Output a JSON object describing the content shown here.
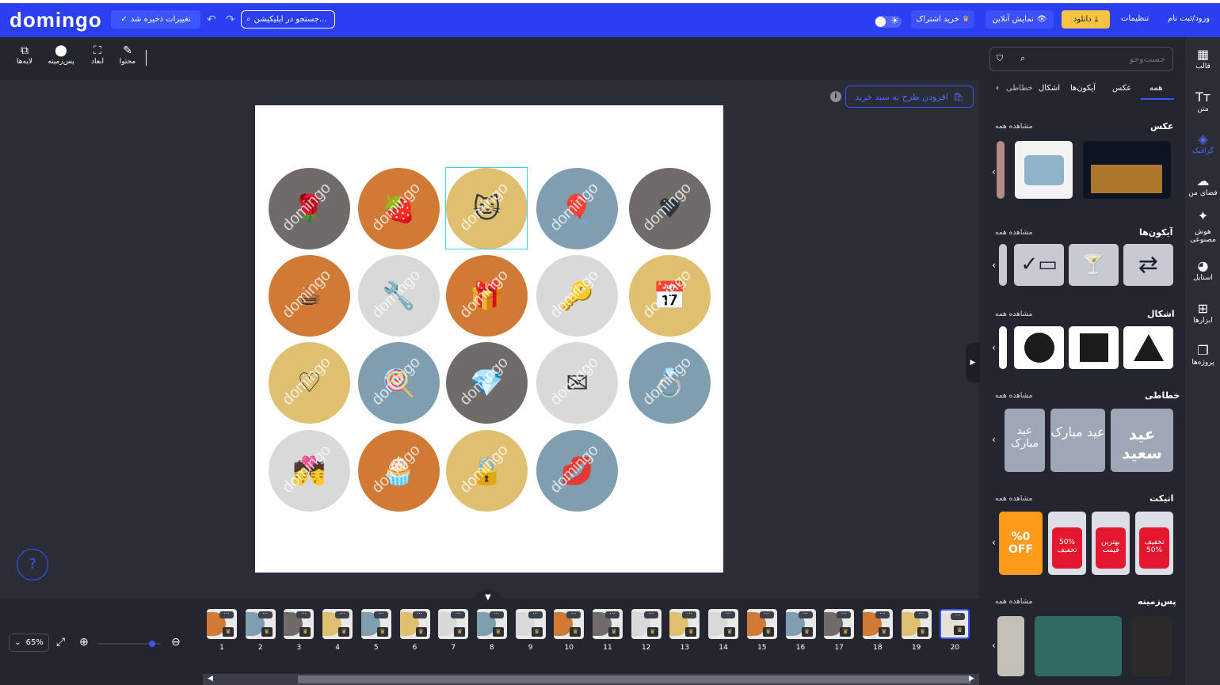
{
  "topbar": {
    "logo": "domingo",
    "saved_label": "تغییرات ذخیره شد",
    "search_placeholder": "جستجو در اپلیکیشن...",
    "subscribe_label": "خرید اشتراک",
    "preview_label": "نمایش آنلاین",
    "download_label": "دانلود",
    "settings_label": "تنظیمات",
    "login_label": "ورود/ثبت نام"
  },
  "toolbar": {
    "content_label": "محتوا",
    "dimensions_label": "ابعاد",
    "background_label": "پس‌زمینه",
    "layers_label": "لایه‌ها"
  },
  "canvas_actions": {
    "add_to_cart_label": "افزودن طرح به سبد خرید",
    "info_icon": "i"
  },
  "canvas": {
    "watermark": "domingo",
    "circles": [
      {
        "color": "#6e6b68",
        "icon": "🌹"
      },
      {
        "color": "#d07a36",
        "icon": "🍓"
      },
      {
        "color": "#dfc070",
        "icon": "🐱"
      },
      {
        "color": "#7f9fb0",
        "icon": "🎈"
      },
      {
        "color": "#6e6b68",
        "icon": "♥"
      },
      {
        "color": "#d07a36",
        "icon": "☕"
      },
      {
        "color": "#d9d9d9",
        "icon": "🔧"
      },
      {
        "color": "#d07a36",
        "icon": "🎁"
      },
      {
        "color": "#d9d9d9",
        "icon": "🔑"
      },
      {
        "color": "#dfc070",
        "icon": "📅"
      },
      {
        "color": "#dfc070",
        "icon": "♡"
      },
      {
        "color": "#7f9fb0",
        "icon": "🍭"
      },
      {
        "color": "#6e6b68",
        "icon": "💎"
      },
      {
        "color": "#d9d9d9",
        "icon": "✉"
      },
      {
        "color": "#7f9fb0",
        "icon": "💍"
      },
      {
        "color": "#d9d9d9",
        "icon": "💏"
      },
      {
        "color": "#d07a36",
        "icon": "🧁"
      },
      {
        "color": "#dfc070",
        "icon": "🔒"
      },
      {
        "color": "#7f9fb0",
        "icon": "💋"
      }
    ]
  },
  "help": {
    "label": "?"
  },
  "zoom": {
    "value": "65%"
  },
  "pages": [
    {
      "num": "1",
      "color": "#d07a36"
    },
    {
      "num": "2",
      "color": "#7f9fb0"
    },
    {
      "num": "3",
      "color": "#6e6b68"
    },
    {
      "num": "4",
      "color": "#dfc070"
    },
    {
      "num": "5",
      "color": "#7f9fb0"
    },
    {
      "num": "6",
      "color": "#dfc070"
    },
    {
      "num": "7",
      "color": "#d9d9d9"
    },
    {
      "num": "8",
      "color": "#7f9fb0"
    },
    {
      "num": "9",
      "color": "#d9d9d9"
    },
    {
      "num": "10",
      "color": "#d07a36"
    },
    {
      "num": "11",
      "color": "#6e6b68"
    },
    {
      "num": "12",
      "color": "#d9d9d9"
    },
    {
      "num": "13",
      "color": "#dfc070"
    },
    {
      "num": "14",
      "color": "#d9d9d9"
    },
    {
      "num": "15",
      "color": "#d07a36"
    },
    {
      "num": "16",
      "color": "#7f9fb0"
    },
    {
      "num": "17",
      "color": "#6e6b68"
    },
    {
      "num": "18",
      "color": "#d07a36"
    },
    {
      "num": "19",
      "color": "#dfc070"
    },
    {
      "num": "20",
      "color": "#e7e2d9"
    }
  ],
  "panel": {
    "search_placeholder": "جست‌وجو",
    "tabs": [
      "همه",
      "عکس",
      "آیکون‌ها",
      "اشکال",
      "خطاطی"
    ],
    "see_all": "مشاهده همه",
    "sections": {
      "photo": "عکس",
      "icons": "آیکون‌ها",
      "shapes": "اشکال",
      "calligraphy": "خطاطی",
      "tags": "اتیکت",
      "backgrounds": "پس‌زمینه"
    },
    "calligraphy_texts": [
      "عید مبارک",
      "عید مبارک",
      "عید سعید"
    ],
    "tag_texts": [
      "%0 OFF",
      "50% تخفیف",
      "بهترین قیمت",
      "تخفیف 50%"
    ]
  },
  "rail": {
    "items": [
      "قالب",
      "متن",
      "گرافیک",
      "فضای من",
      "هوش مصنوعی",
      "استایل",
      "ابزارها",
      "پروژه‌ها"
    ]
  }
}
